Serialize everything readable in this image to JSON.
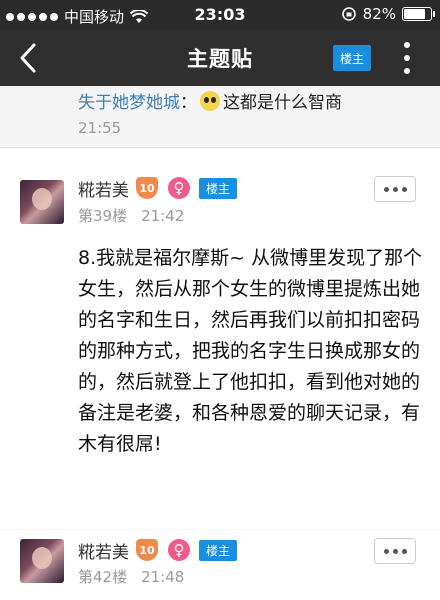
{
  "status_bar": {
    "carrier": "中国移动",
    "time": "23:03",
    "battery_text": "82%",
    "battery_level": 0.82
  },
  "nav": {
    "title": "主题贴",
    "owner_button": "楼主"
  },
  "reply": {
    "user": "失于她梦她城",
    "separator": "：",
    "text": "这都是什么智商",
    "time": "21:55"
  },
  "posts": [
    {
      "username": "糀若美",
      "level": "10",
      "gender_symbol": "♀",
      "tag": "楼主",
      "floor": "第39楼",
      "time": "21:42",
      "content": "8.我就是福尔摩斯~ 从微博里发现了那个女生，然后从那个女生的微博里提炼出她的名字和生日，然后再我们以前扣扣密码的那种方式，把我的名字生日换成那女的的，然后就登上了他扣扣，看到他对她的备注是老婆，和各种恩爱的聊天记录，有木有很屌!"
    },
    {
      "username": "糀若美",
      "level": "10",
      "gender_symbol": "♀",
      "tag": "楼主",
      "floor": "第42楼",
      "time": "21:48"
    }
  ],
  "colors": {
    "accent": "#1a8fe0",
    "nav_bg": "#2f2f2f",
    "link": "#3d7fb8",
    "level": "#f08a4b",
    "female": "#f25a8a"
  }
}
